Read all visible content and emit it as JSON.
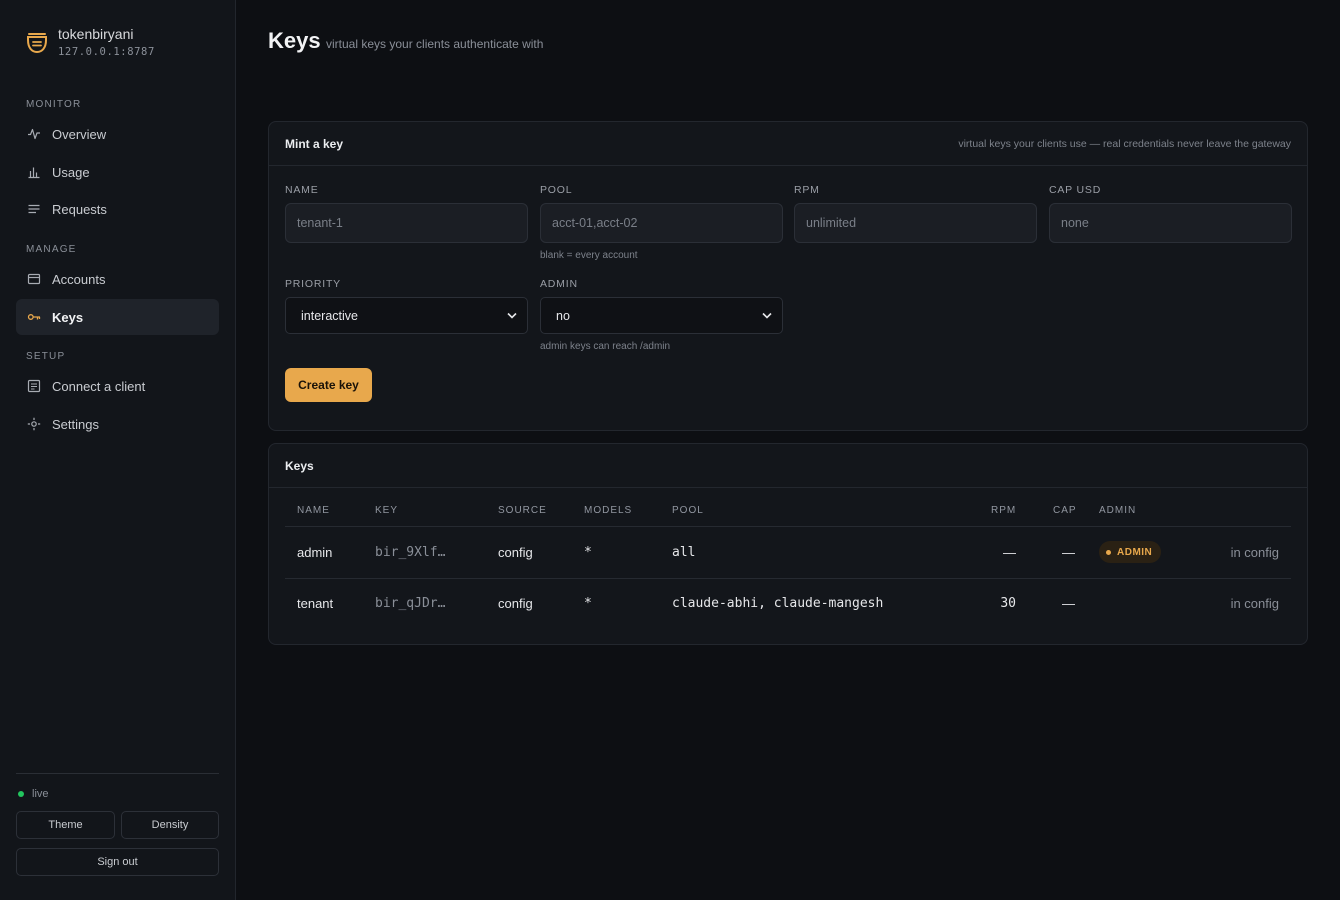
{
  "brand": {
    "name": "tokenbiryani",
    "host": "127.0.0.1:8787"
  },
  "nav": {
    "monitor_label": "MONITOR",
    "manage_label": "MANAGE",
    "setup_label": "SETUP",
    "items": [
      {
        "label": "Overview",
        "icon": "activity-icon"
      },
      {
        "label": "Usage",
        "icon": "bar-chart-icon"
      },
      {
        "label": "Requests",
        "icon": "list-icon"
      },
      {
        "label": "Accounts",
        "icon": "card-icon"
      },
      {
        "label": "Keys",
        "icon": "key-icon",
        "active": true
      },
      {
        "label": "Connect a client",
        "icon": "terminal-icon"
      },
      {
        "label": "Settings",
        "icon": "settings-icon"
      }
    ]
  },
  "footer": {
    "status": "live",
    "theme_label": "Theme",
    "density_label": "Density",
    "signout_label": "Sign out"
  },
  "page": {
    "title": "Keys",
    "subtitle": "virtual keys your clients authenticate with"
  },
  "mint": {
    "title": "Mint a key",
    "hint": "virtual keys your clients use — real credentials never leave the gateway",
    "fields": {
      "name": {
        "label": "NAME",
        "placeholder": "tenant-1"
      },
      "pool": {
        "label": "POOL",
        "placeholder": "acct-01,acct-02",
        "help": "blank = every account"
      },
      "rpm": {
        "label": "RPM",
        "placeholder": "unlimited"
      },
      "cap": {
        "label": "CAP USD",
        "placeholder": "none"
      },
      "priority": {
        "label": "PRIORITY",
        "value": "interactive"
      },
      "admin": {
        "label": "ADMIN",
        "value": "no",
        "help": "admin keys can reach /admin"
      }
    },
    "create_label": "Create key"
  },
  "keys_table": {
    "title": "Keys",
    "columns": [
      "NAME",
      "KEY",
      "SOURCE",
      "MODELS",
      "POOL",
      "RPM",
      "CAP",
      "ADMIN"
    ],
    "rows": [
      {
        "name": "admin",
        "key": "bir_9Xlf…",
        "source": "config",
        "models": "*",
        "pool": "all",
        "rpm": "—",
        "cap": "—",
        "admin": "ADMIN",
        "action": "in config"
      },
      {
        "name": "tenant",
        "key": "bir_qJDr…",
        "source": "config",
        "models": "*",
        "pool": "claude-abhi, claude-mangesh",
        "rpm": "30",
        "cap": "—",
        "admin": "",
        "action": "in config"
      }
    ]
  },
  "colors": {
    "accent": "#e8a84c",
    "live": "#22c55e",
    "background": "#0d0f13",
    "sidebar": "#12151a"
  }
}
